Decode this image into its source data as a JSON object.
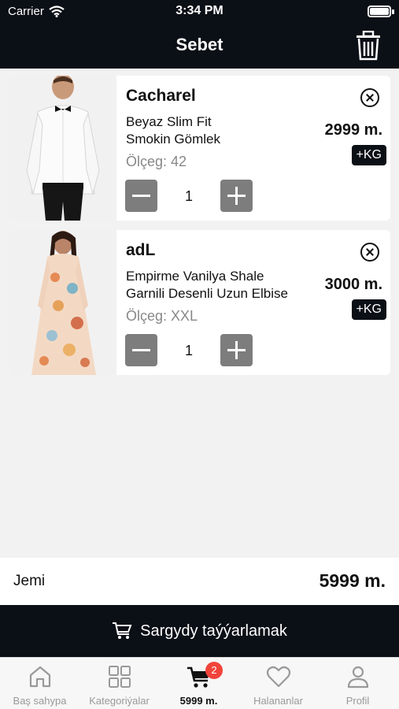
{
  "status_bar": {
    "carrier": "Carrier",
    "time": "3:34 PM"
  },
  "header": {
    "title": "Sebet"
  },
  "cart": {
    "items": [
      {
        "brand": "Cacharel",
        "name_line1": "Beyaz Slim Fit",
        "name_line2": "Smokin Gömlek",
        "size_label": "Ölçeg: 42",
        "price": "2999 m.",
        "tag": "+KG",
        "quantity": "1"
      },
      {
        "brand": "adL",
        "name_line1": "Empirme Vanilya Shale",
        "name_line2": "Garnili Desenli Uzun Elbise",
        "size_label": "Ölçeg: XXL",
        "price": "3000 m.",
        "tag": "+KG",
        "quantity": "1"
      }
    ]
  },
  "total": {
    "label": "Jemi",
    "value": "5999 m."
  },
  "checkout": {
    "label": "Sargydy taýýarlamak"
  },
  "tabs": [
    {
      "label": "Baş sahypa",
      "icon": "home-icon"
    },
    {
      "label": "Kategoriýalar",
      "icon": "grid-icon"
    },
    {
      "label": "5999 m.",
      "icon": "cart-icon",
      "badge": "2",
      "active": true
    },
    {
      "label": "Halananlar",
      "icon": "heart-icon"
    },
    {
      "label": "Profil",
      "icon": "user-icon"
    }
  ],
  "colors": {
    "dark": "#0b0f16",
    "badge": "#f0443a",
    "stepper": "#7d7d7d"
  }
}
